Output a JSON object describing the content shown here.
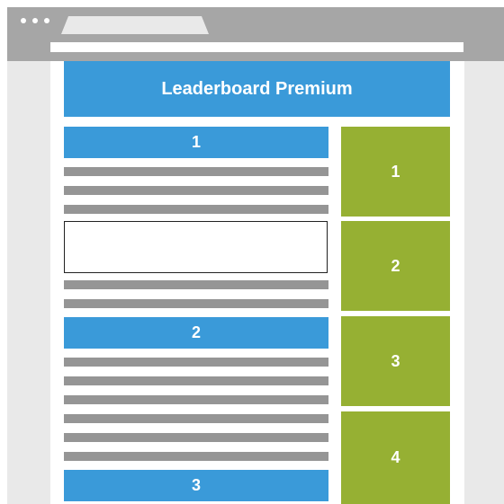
{
  "header": {
    "title": "Leaderboard Premium"
  },
  "content_blocks": [
    {
      "label": "1"
    },
    {
      "label": "2"
    },
    {
      "label": "3"
    }
  ],
  "sidebar_ads": [
    {
      "label": "1"
    },
    {
      "label": "2"
    },
    {
      "label": "3"
    },
    {
      "label": "4"
    }
  ],
  "colors": {
    "header_blue": "#3a9ad9",
    "sidebar_green": "#96b033",
    "text_line_gray": "#959595",
    "browser_chrome_gray": "#a6a6a6"
  }
}
